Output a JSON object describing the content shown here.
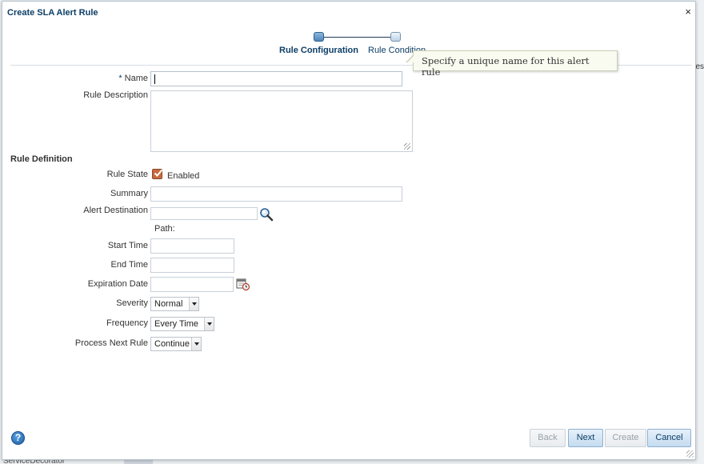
{
  "background": {
    "bottom_text": "ServiceDecorator",
    "right_text": "es"
  },
  "dialog": {
    "title": "Create SLA Alert Rule",
    "close_glyph": "×"
  },
  "train": {
    "steps": [
      {
        "label": "Rule Configuration",
        "active": true
      },
      {
        "label": "Rule Condition",
        "active": false
      }
    ]
  },
  "tooltip": {
    "text": "Specify a unique name for this alert rule"
  },
  "form": {
    "name": {
      "required_marker": "*",
      "label": "Name",
      "value": ""
    },
    "description": {
      "label": "Rule Description",
      "value": ""
    },
    "section_title": "Rule Definition",
    "rule_state": {
      "label": "Rule State",
      "checkbox_label": "Enabled",
      "checked": true
    },
    "summary": {
      "label": "Summary",
      "value": ""
    },
    "alert_destination": {
      "label": "Alert Destination",
      "value": "",
      "path_label": "Path:"
    },
    "start_time": {
      "label": "Start Time",
      "value": ""
    },
    "end_time": {
      "label": "End Time",
      "value": ""
    },
    "expiration_date": {
      "label": "Expiration Date",
      "value": ""
    },
    "severity": {
      "label": "Severity",
      "selected": "Normal"
    },
    "frequency": {
      "label": "Frequency",
      "selected": "Every Time"
    },
    "process_next_rule": {
      "label": "Process Next Rule",
      "selected": "Continue"
    }
  },
  "footer": {
    "help_glyph": "?",
    "back_label": "Back",
    "next_label": "Next",
    "create_label": "Create",
    "cancel_label": "Cancel"
  },
  "colors": {
    "accent": "#0c3e66",
    "checkbox": "#c86a3d",
    "tooltip_bg": "#fafbf0"
  }
}
